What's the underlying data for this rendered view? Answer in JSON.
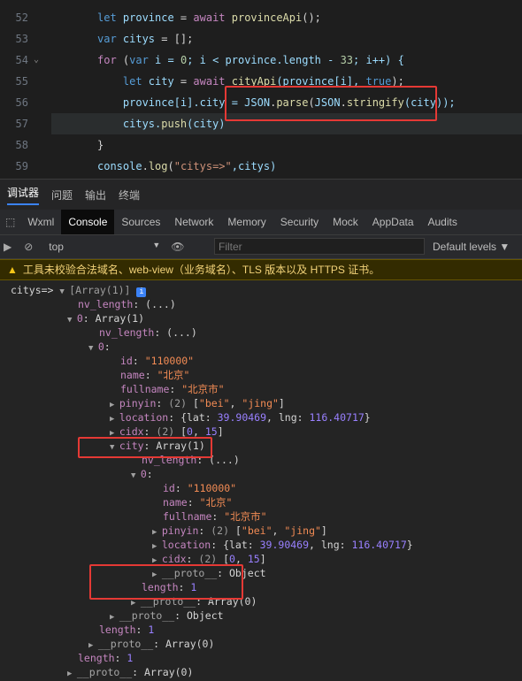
{
  "editor": {
    "lines": [
      {
        "n": "52",
        "code": [
          {
            "t": "let ",
            "c": "kw"
          },
          {
            "t": "province",
            "c": "var"
          },
          {
            "t": " = ",
            "c": "plain"
          },
          {
            "t": "await ",
            "c": "kw2"
          },
          {
            "t": "provinceApi",
            "c": "fn"
          },
          {
            "t": "();",
            "c": "plain"
          }
        ]
      },
      {
        "n": "53",
        "code": [
          {
            "t": "var ",
            "c": "kw"
          },
          {
            "t": "citys",
            "c": "var"
          },
          {
            "t": " = [];",
            "c": "plain"
          }
        ]
      },
      {
        "n": "54",
        "code": [
          {
            "t": "for ",
            "c": "kw2"
          },
          {
            "t": "(",
            "c": "plain"
          },
          {
            "t": "var ",
            "c": "kw"
          },
          {
            "t": "i = ",
            "c": "var"
          },
          {
            "t": "0",
            "c": "num"
          },
          {
            "t": "; i < province.length - ",
            "c": "var"
          },
          {
            "t": "33",
            "c": "num"
          },
          {
            "t": "; i++) {",
            "c": "var"
          }
        ]
      },
      {
        "n": "55",
        "code": [
          {
            "t": "    let ",
            "c": "kw"
          },
          {
            "t": "city",
            "c": "var"
          },
          {
            "t": " = ",
            "c": "plain"
          },
          {
            "t": "await ",
            "c": "kw2"
          },
          {
            "t": "cityApi",
            "c": "fn"
          },
          {
            "t": "(province[i], ",
            "c": "var"
          },
          {
            "t": "true",
            "c": "kw"
          },
          {
            "t": ");",
            "c": "plain"
          }
        ]
      },
      {
        "n": "56",
        "code": [
          {
            "t": "    province[i].city = ",
            "c": "var"
          },
          {
            "t": "JSON",
            "c": "var"
          },
          {
            "t": ".",
            "c": "plain"
          },
          {
            "t": "parse",
            "c": "fn"
          },
          {
            "t": "(",
            "c": "plain"
          },
          {
            "t": "JSON",
            "c": "var"
          },
          {
            "t": ".",
            "c": "plain"
          },
          {
            "t": "stringify",
            "c": "fn"
          },
          {
            "t": "(city));",
            "c": "var"
          }
        ]
      },
      {
        "n": "57",
        "code": [
          {
            "t": "    citys.",
            "c": "var"
          },
          {
            "t": "push",
            "c": "fn"
          },
          {
            "t": "(city)",
            "c": "var"
          }
        ]
      },
      {
        "n": "58",
        "code": [
          {
            "t": "}",
            "c": "plain"
          }
        ]
      },
      {
        "n": "59",
        "code": [
          {
            "t": "console",
            "c": "var"
          },
          {
            "t": ".",
            "c": "plain"
          },
          {
            "t": "log",
            "c": "fn"
          },
          {
            "t": "(",
            "c": "plain"
          },
          {
            "t": "\"citys=>\"",
            "c": "str"
          },
          {
            "t": ",citys)",
            "c": "var"
          }
        ]
      }
    ]
  },
  "panel_tabs": [
    "调试器",
    "问题",
    "输出",
    "终端"
  ],
  "devtools_tabs": [
    "Wxml",
    "Console",
    "Sources",
    "Network",
    "Memory",
    "Security",
    "Mock",
    "AppData",
    "Audits"
  ],
  "toolbar": {
    "context": "top",
    "filter_placeholder": "Filter",
    "levels": "Default levels ▼"
  },
  "warning": "工具未校验合法域名、web-view（业务域名）、TLS 版本以及 HTTPS 证书。",
  "console_rows": [
    {
      "i": 0,
      "parts": [
        {
          "t": "citys=> ",
          "c": "plain"
        },
        {
          "t": "▼ ",
          "c": "tri"
        },
        {
          "t": "[Array(1)] ",
          "c": "grey"
        },
        {
          "t": "i",
          "c": "badge"
        }
      ]
    },
    {
      "i": 6,
      "parts": [
        {
          "t": "nv_length",
          "c": "key"
        },
        {
          "t": ": (...)",
          "c": "plain"
        }
      ]
    },
    {
      "i": 5,
      "parts": [
        {
          "t": "▼ ",
          "c": "tri"
        },
        {
          "t": "0",
          "c": "key"
        },
        {
          "t": ": Array(1)",
          "c": "plain"
        }
      ]
    },
    {
      "i": 8,
      "parts": [
        {
          "t": "nv_length",
          "c": "key"
        },
        {
          "t": ": (...)",
          "c": "plain"
        }
      ]
    },
    {
      "i": 7,
      "parts": [
        {
          "t": "▼ ",
          "c": "tri"
        },
        {
          "t": "0",
          "c": "key"
        },
        {
          "t": ":",
          "c": "plain"
        }
      ]
    },
    {
      "i": 10,
      "parts": [
        {
          "t": "id",
          "c": "key"
        },
        {
          "t": ": ",
          "c": "plain"
        },
        {
          "t": "\"110000\"",
          "c": "val-str"
        }
      ]
    },
    {
      "i": 10,
      "parts": [
        {
          "t": "name",
          "c": "key"
        },
        {
          "t": ": ",
          "c": "plain"
        },
        {
          "t": "\"北京\"",
          "c": "val-str"
        }
      ]
    },
    {
      "i": 10,
      "parts": [
        {
          "t": "fullname",
          "c": "key"
        },
        {
          "t": ": ",
          "c": "plain"
        },
        {
          "t": "\"北京市\"",
          "c": "val-str"
        }
      ]
    },
    {
      "i": 9,
      "parts": [
        {
          "t": "▶ ",
          "c": "tri"
        },
        {
          "t": "pinyin",
          "c": "key"
        },
        {
          "t": ": ",
          "c": "plain"
        },
        {
          "t": "(2) ",
          "c": "grey"
        },
        {
          "t": "[",
          "c": "plain"
        },
        {
          "t": "\"bei\"",
          "c": "val-str"
        },
        {
          "t": ", ",
          "c": "plain"
        },
        {
          "t": "\"jing\"",
          "c": "val-str"
        },
        {
          "t": "]",
          "c": "plain"
        }
      ]
    },
    {
      "i": 9,
      "parts": [
        {
          "t": "▶ ",
          "c": "tri"
        },
        {
          "t": "location",
          "c": "key"
        },
        {
          "t": ": {lat: ",
          "c": "plain"
        },
        {
          "t": "39.90469",
          "c": "val-num"
        },
        {
          "t": ", lng: ",
          "c": "plain"
        },
        {
          "t": "116.40717",
          "c": "val-num"
        },
        {
          "t": "}",
          "c": "plain"
        }
      ]
    },
    {
      "i": 9,
      "parts": [
        {
          "t": "▶ ",
          "c": "tri"
        },
        {
          "t": "cidx",
          "c": "key"
        },
        {
          "t": ": ",
          "c": "plain"
        },
        {
          "t": "(2) ",
          "c": "grey"
        },
        {
          "t": "[",
          "c": "plain"
        },
        {
          "t": "0",
          "c": "val-num"
        },
        {
          "t": ", ",
          "c": "plain"
        },
        {
          "t": "15",
          "c": "val-num"
        },
        {
          "t": "]",
          "c": "plain"
        }
      ]
    },
    {
      "i": 9,
      "parts": [
        {
          "t": "▼ ",
          "c": "tri"
        },
        {
          "t": "city",
          "c": "key"
        },
        {
          "t": ": Array(1)",
          "c": "plain"
        }
      ]
    },
    {
      "i": 12,
      "parts": [
        {
          "t": "nv_length",
          "c": "key"
        },
        {
          "t": ": (...)",
          "c": "plain"
        }
      ]
    },
    {
      "i": 11,
      "parts": [
        {
          "t": "▼ ",
          "c": "tri"
        },
        {
          "t": "0",
          "c": "key"
        },
        {
          "t": ":",
          "c": "plain"
        }
      ]
    },
    {
      "i": 14,
      "parts": [
        {
          "t": "id",
          "c": "key"
        },
        {
          "t": ": ",
          "c": "plain"
        },
        {
          "t": "\"110000\"",
          "c": "val-str"
        }
      ]
    },
    {
      "i": 14,
      "parts": [
        {
          "t": "name",
          "c": "key"
        },
        {
          "t": ": ",
          "c": "plain"
        },
        {
          "t": "\"北京\"",
          "c": "val-str"
        }
      ]
    },
    {
      "i": 14,
      "parts": [
        {
          "t": "fullname",
          "c": "key"
        },
        {
          "t": ": ",
          "c": "plain"
        },
        {
          "t": "\"北京市\"",
          "c": "val-str"
        }
      ]
    },
    {
      "i": 13,
      "parts": [
        {
          "t": "▶ ",
          "c": "tri"
        },
        {
          "t": "pinyin",
          "c": "key"
        },
        {
          "t": ": ",
          "c": "plain"
        },
        {
          "t": "(2) ",
          "c": "grey"
        },
        {
          "t": "[",
          "c": "plain"
        },
        {
          "t": "\"bei\"",
          "c": "val-str"
        },
        {
          "t": ", ",
          "c": "plain"
        },
        {
          "t": "\"jing\"",
          "c": "val-str"
        },
        {
          "t": "]",
          "c": "plain"
        }
      ]
    },
    {
      "i": 13,
      "parts": [
        {
          "t": "▶ ",
          "c": "tri"
        },
        {
          "t": "location",
          "c": "key"
        },
        {
          "t": ": {lat: ",
          "c": "plain"
        },
        {
          "t": "39.90469",
          "c": "val-num"
        },
        {
          "t": ", lng: ",
          "c": "plain"
        },
        {
          "t": "116.40717",
          "c": "val-num"
        },
        {
          "t": "}",
          "c": "plain"
        }
      ]
    },
    {
      "i": 13,
      "parts": [
        {
          "t": "▶ ",
          "c": "tri"
        },
        {
          "t": "cidx",
          "c": "key"
        },
        {
          "t": ": ",
          "c": "plain"
        },
        {
          "t": "(2) ",
          "c": "grey"
        },
        {
          "t": "[",
          "c": "plain"
        },
        {
          "t": "0",
          "c": "val-num"
        },
        {
          "t": ", ",
          "c": "plain"
        },
        {
          "t": "15",
          "c": "val-num"
        },
        {
          "t": "]",
          "c": "plain"
        }
      ]
    },
    {
      "i": 13,
      "parts": [
        {
          "t": "▶ ",
          "c": "tri"
        },
        {
          "t": "__proto__",
          "c": "key2"
        },
        {
          "t": ": Object",
          "c": "plain"
        }
      ]
    },
    {
      "i": 12,
      "parts": [
        {
          "t": "length",
          "c": "key"
        },
        {
          "t": ": ",
          "c": "plain"
        },
        {
          "t": "1",
          "c": "val-num"
        }
      ]
    },
    {
      "i": 11,
      "parts": [
        {
          "t": "▶ ",
          "c": "tri"
        },
        {
          "t": "__proto__",
          "c": "key2"
        },
        {
          "t": ": Array(0)",
          "c": "plain"
        }
      ]
    },
    {
      "i": 9,
      "parts": [
        {
          "t": "▶ ",
          "c": "tri"
        },
        {
          "t": "__proto__",
          "c": "key2"
        },
        {
          "t": ": Object",
          "c": "plain"
        }
      ]
    },
    {
      "i": 8,
      "parts": [
        {
          "t": "length",
          "c": "key"
        },
        {
          "t": ": ",
          "c": "plain"
        },
        {
          "t": "1",
          "c": "val-num"
        }
      ]
    },
    {
      "i": 7,
      "parts": [
        {
          "t": "▶ ",
          "c": "tri"
        },
        {
          "t": "__proto__",
          "c": "key2"
        },
        {
          "t": ": Array(0)",
          "c": "plain"
        }
      ]
    },
    {
      "i": 6,
      "parts": [
        {
          "t": "length",
          "c": "key"
        },
        {
          "t": ": ",
          "c": "plain"
        },
        {
          "t": "1",
          "c": "val-num"
        }
      ]
    },
    {
      "i": 5,
      "parts": [
        {
          "t": "▶ ",
          "c": "tri"
        },
        {
          "t": "__proto__",
          "c": "key2"
        },
        {
          "t": ": Array(0)",
          "c": "plain"
        }
      ]
    }
  ],
  "colors": {
    "highlight_box": "#e53935",
    "active_tab_underline": "#3b82f6"
  }
}
